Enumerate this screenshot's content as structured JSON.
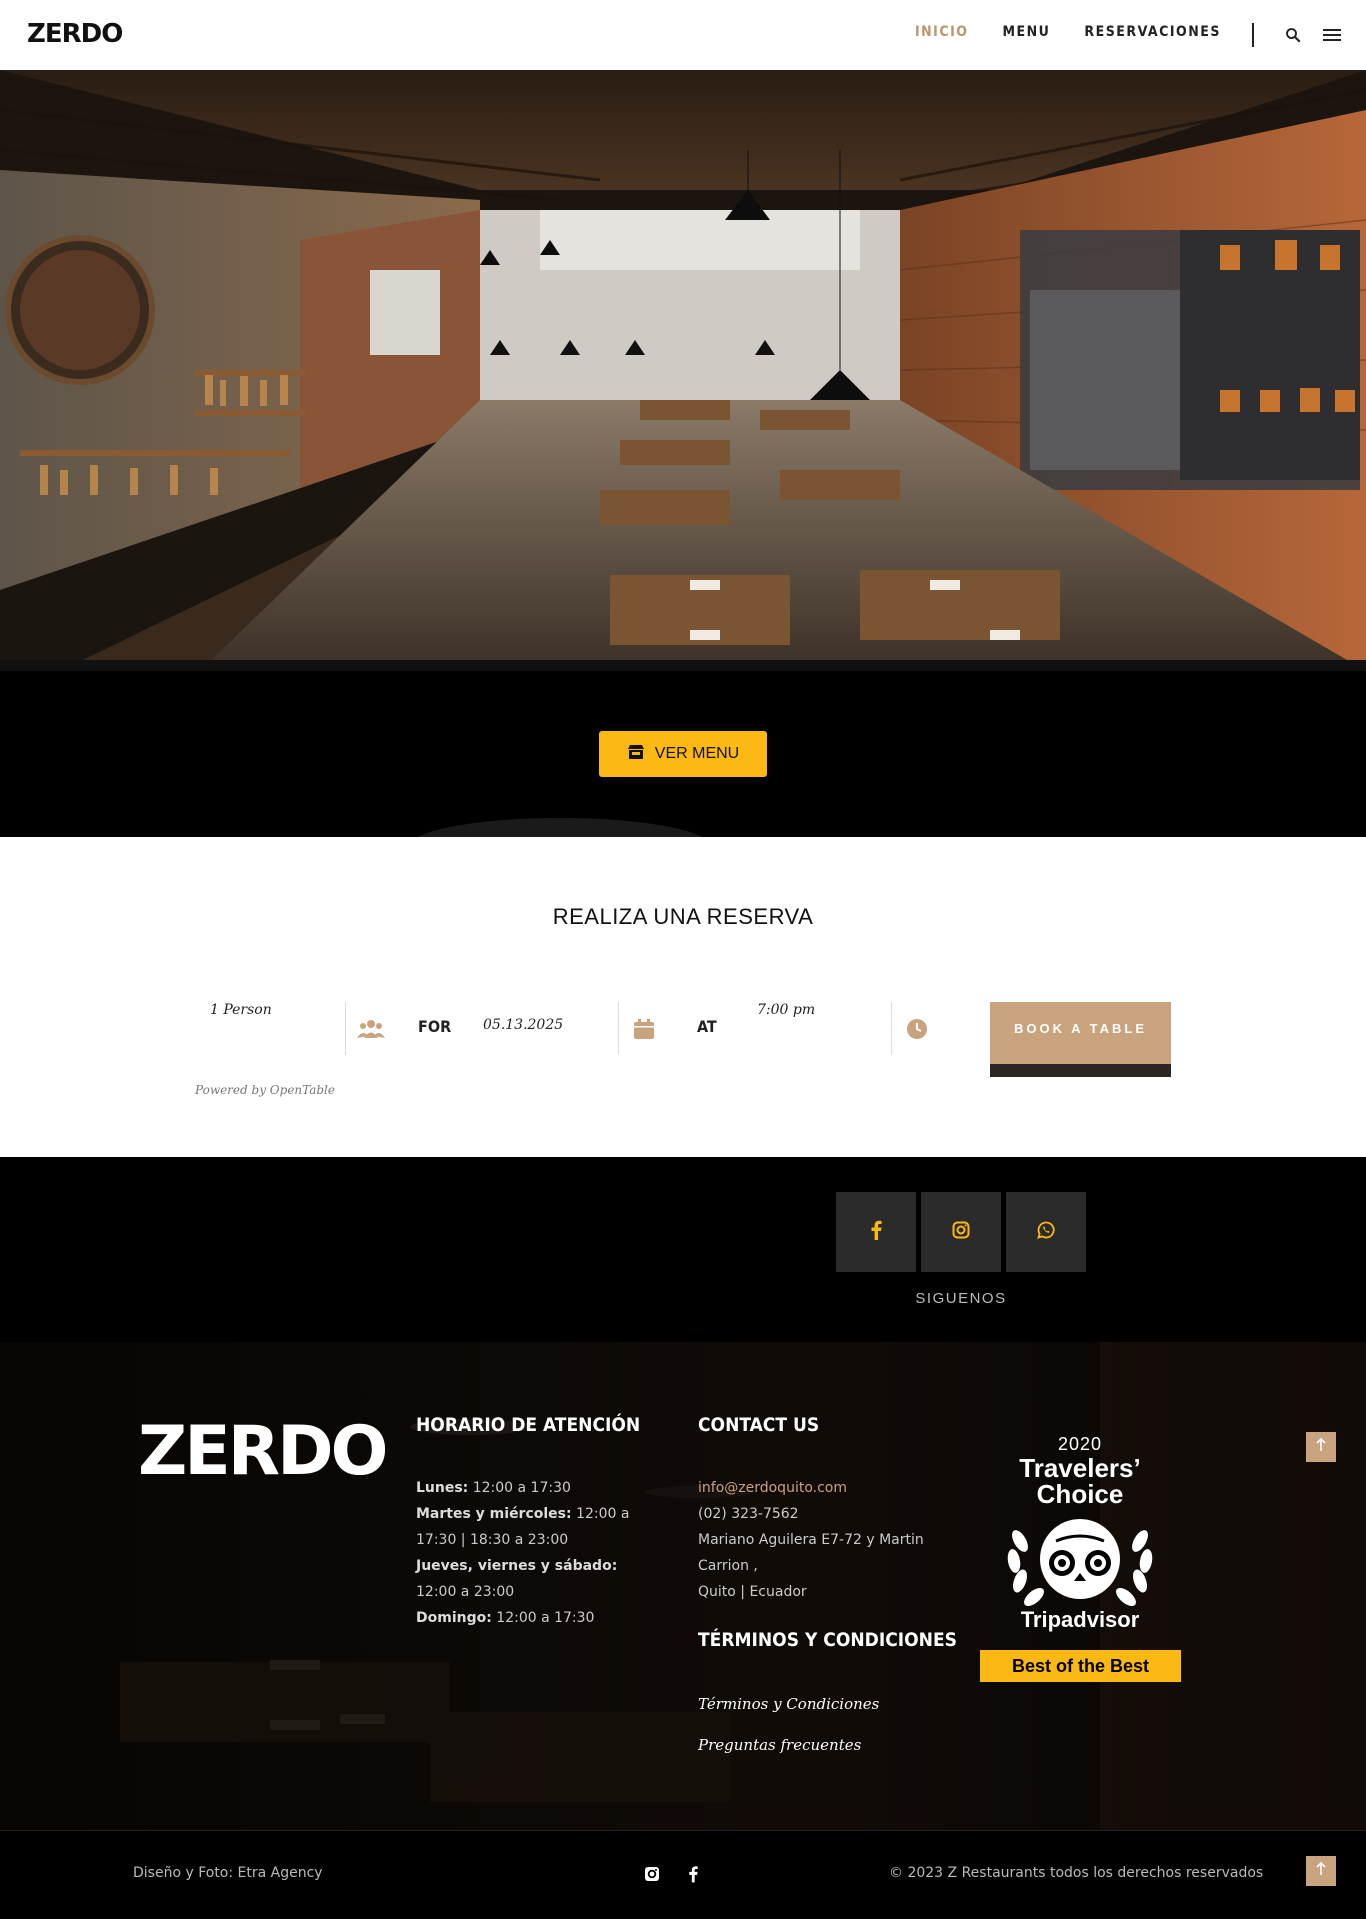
{
  "header": {
    "logo": "ZERDO",
    "nav": [
      {
        "label": "INICIO",
        "active": true
      },
      {
        "label": "MENU",
        "active": false
      },
      {
        "label": "RESERVACIONES",
        "active": false
      }
    ],
    "search_icon": "search-icon",
    "menu_icon": "hamburger-icon"
  },
  "hero": {
    "button_label": "VER MENU",
    "button_icon": "store-icon",
    "button_color": "#fdb913"
  },
  "reservation": {
    "title": "REALIZA UNA RESERVA",
    "party": "1 Person",
    "for_label": "FOR",
    "date": "05.13.2025",
    "at_label": "AT",
    "time": "7:00 pm",
    "book_label": "BOOK A TABLE",
    "powered_by": "Powered by OpenTable",
    "accent": "#c9a27e"
  },
  "social": {
    "label": "SIGUENOS",
    "icons": [
      "facebook-icon",
      "instagram-icon",
      "whatsapp-icon"
    ],
    "icon_color": "#fdb913"
  },
  "footer": {
    "logo": "ZERDO",
    "hours": {
      "heading": "HORARIO DE ATENCIÓN",
      "rows": [
        {
          "day": "Lunes:",
          "time": " 12:00 a 17:30"
        },
        {
          "day": "Martes y miércoles:",
          "time": " 12:00 a 17:30 | 18:30 a 23:00"
        },
        {
          "day": "Jueves, viernes y sábado:",
          "time": " 12:00 a 23:00"
        },
        {
          "day": "Domingo:",
          "time": " 12:00 a 17:30"
        }
      ]
    },
    "contact": {
      "heading": "CONTACT US",
      "email": "info@zerdoquito.com",
      "phone": "(02) 323-7562",
      "address": "Mariano Aguilera E7-72 y Martin Carrion ,",
      "city": "Quito | Ecuador"
    },
    "terms": {
      "heading": "TÉRMINOS Y CONDICIONES",
      "links": [
        "Términos y Condiciones",
        "Preguntas frecuentes"
      ]
    },
    "award": {
      "year": "2020",
      "line1": "Travelers’",
      "line2": "Choice",
      "brand": "Tripadvisor",
      "ribbon": "Best of the Best"
    }
  },
  "bottom": {
    "credit": "Diseño y Foto: Etra Agency",
    "copyright": "© 2023 Z Restaurants todos los derechos reservados"
  }
}
